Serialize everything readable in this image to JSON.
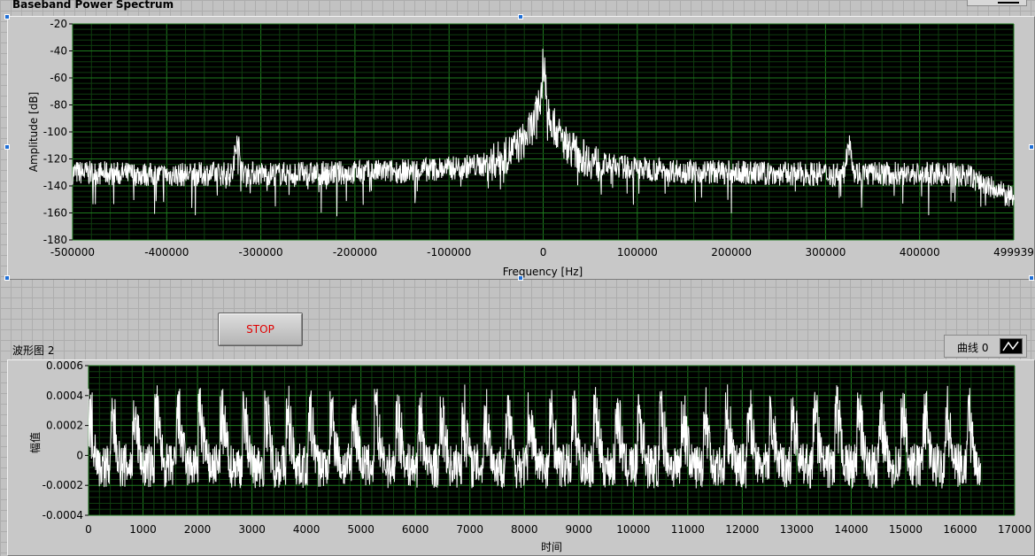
{
  "chart_data": [
    {
      "type": "line",
      "title": "Baseband Power Spectrum",
      "xlabel": "Frequency [Hz]",
      "ylabel": "Amplitude [dB]",
      "xlim": [
        -500000,
        499939
      ],
      "ylim": [
        -180,
        -20
      ],
      "x_ticks": [
        "-500000",
        "-400000",
        "-300000",
        "-200000",
        "-100000",
        "0",
        "100000",
        "200000",
        "300000",
        "400000",
        "499939"
      ],
      "y_ticks": [
        "-20",
        "-40",
        "-60",
        "-80",
        "-100",
        "-120",
        "-140",
        "-160",
        "-180"
      ],
      "grid": true,
      "line_color": "#ffffff",
      "background": "#000000",
      "grid_color": "#1e7a1e",
      "series": [
        {
          "x": [
            -500000,
            -450000,
            -400000,
            -350000,
            -330000,
            -325000,
            -320000,
            -300000,
            -250000,
            -200000,
            -150000,
            -100000,
            -60000,
            -40000,
            -20000,
            -10000,
            -5000,
            -2000,
            0,
            2000,
            5000,
            10000,
            20000,
            40000,
            60000,
            100000,
            150000,
            200000,
            250000,
            300000,
            320000,
            325000,
            330000,
            350000,
            400000,
            450000,
            499939
          ],
          "values": [
            -130,
            -131,
            -132,
            -131,
            -131,
            -100,
            -130,
            -131,
            -131,
            -130,
            -129,
            -127,
            -124,
            -118,
            -106,
            -94,
            -80,
            -62,
            -36,
            -62,
            -80,
            -94,
            -106,
            -118,
            -124,
            -127,
            -129,
            -130,
            -131,
            -131,
            -131,
            -100,
            -130,
            -131,
            -131,
            -132,
            -150
          ]
        }
      ]
    },
    {
      "type": "line",
      "title": "波形图 2",
      "xlabel": "时间",
      "ylabel": "幅值",
      "xlim": [
        0,
        17000
      ],
      "ylim": [
        -0.0004,
        0.0006
      ],
      "x_ticks": [
        "0",
        "1000",
        "2000",
        "3000",
        "4000",
        "5000",
        "6000",
        "7000",
        "8000",
        "9000",
        "10000",
        "11000",
        "12000",
        "13000",
        "14000",
        "15000",
        "16000",
        "17000"
      ],
      "y_ticks": [
        "0.0006",
        "0.0004",
        "0.0002",
        "0",
        "-0.0002",
        "-0.0004"
      ],
      "grid": true,
      "line_color": "#ffffff",
      "background": "#000000",
      "grid_color": "#1e7a1e",
      "series": [
        {
          "name": "曲线 0",
          "x_end": 16380,
          "period": 403,
          "peak": 0.00048,
          "floor": -0.00022,
          "mid": 5e-05
        }
      ]
    }
  ],
  "stop_button": {
    "label": "STOP",
    "text_color": "#e00000"
  },
  "legend": {
    "label": "曲线 0",
    "icon": "line-plot-icon"
  }
}
